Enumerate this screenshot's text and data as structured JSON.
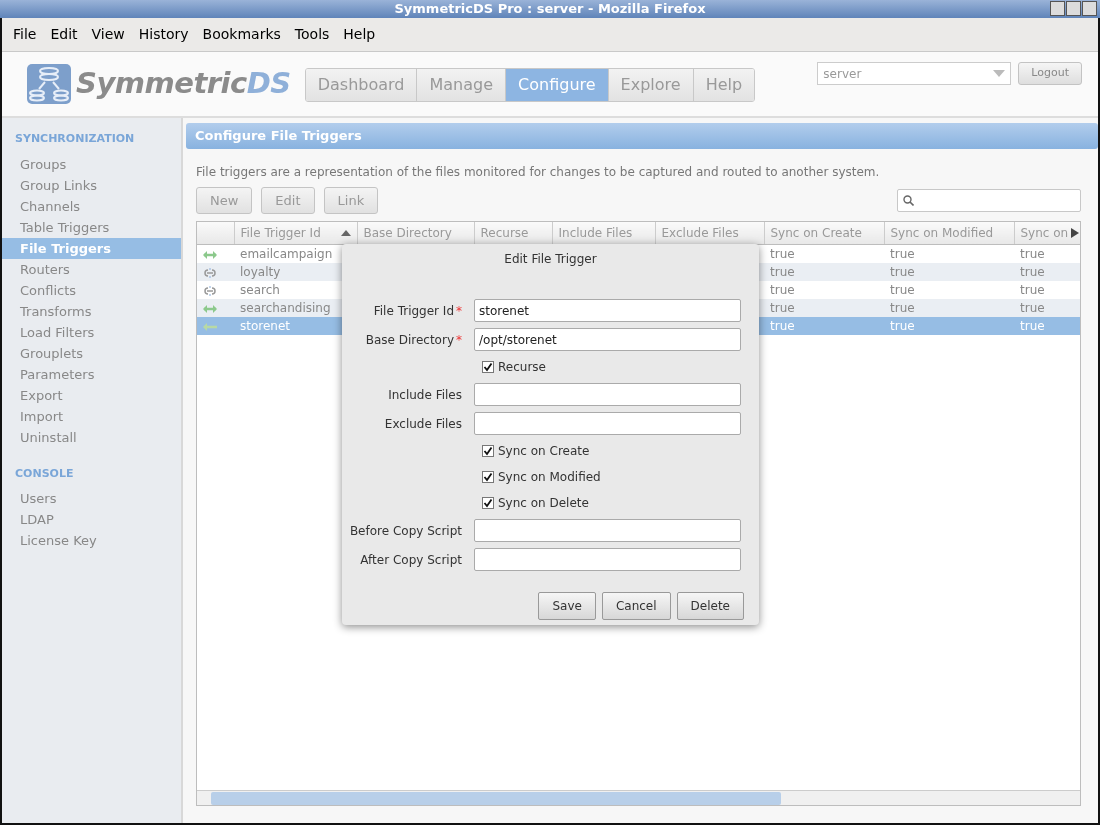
{
  "window": {
    "title": "SymmetricDS Pro : server - Mozilla Firefox"
  },
  "menu": [
    {
      "label": "File"
    },
    {
      "label": "Edit"
    },
    {
      "label": "View"
    },
    {
      "label": "History"
    },
    {
      "label": "Bookmarks"
    },
    {
      "label": "Tools"
    },
    {
      "label": "Help"
    }
  ],
  "logo": {
    "name": "Symmetric",
    "suffix": "DS"
  },
  "nav": [
    {
      "label": "Dashboard",
      "selected": false
    },
    {
      "label": "Manage",
      "selected": false
    },
    {
      "label": "Configure",
      "selected": true
    },
    {
      "label": "Explore",
      "selected": false
    },
    {
      "label": "Help",
      "selected": false
    }
  ],
  "server_select": {
    "value": "server"
  },
  "logout": "Logout",
  "sidebar": [
    {
      "heading": "SYNCHRONIZATION",
      "items": [
        {
          "label": "Groups",
          "selected": false
        },
        {
          "label": "Group Links",
          "selected": false
        },
        {
          "label": "Channels",
          "selected": false
        },
        {
          "label": "Table Triggers",
          "selected": false
        },
        {
          "label": "File Triggers",
          "selected": true
        },
        {
          "label": "Routers",
          "selected": false
        },
        {
          "label": "Conflicts",
          "selected": false
        },
        {
          "label": "Transforms",
          "selected": false
        },
        {
          "label": "Load Filters",
          "selected": false
        },
        {
          "label": "Grouplets",
          "selected": false
        },
        {
          "label": "Parameters",
          "selected": false
        },
        {
          "label": "Export",
          "selected": false
        },
        {
          "label": "Import",
          "selected": false
        },
        {
          "label": "Uninstall",
          "selected": false
        }
      ]
    },
    {
      "heading": "CONSOLE",
      "items": [
        {
          "label": "Users",
          "selected": false
        },
        {
          "label": "LDAP",
          "selected": false
        },
        {
          "label": "License Key",
          "selected": false
        }
      ]
    }
  ],
  "page_title": "Configure File Triggers",
  "description": "File triggers are a representation of the files monitored for changes to be captured and routed to another system.",
  "toolbar": [
    "New",
    "Edit",
    "Link"
  ],
  "table": {
    "columns": [
      "File Trigger Id",
      "Base Directory",
      "Recurse",
      "Include Files",
      "Exclude Files",
      "Sync on Create",
      "Sync on Modified",
      "Sync on"
    ],
    "rows": [
      {
        "kind": "both",
        "selected": false,
        "id": "emailcampaign",
        "sync_on_create": "true",
        "sync_on_modified": "true",
        "sync_on_delete": "true"
      },
      {
        "kind": "unlinked",
        "selected": false,
        "id": "loyalty",
        "sync_on_create": "true",
        "sync_on_modified": "true",
        "sync_on_delete": "true"
      },
      {
        "kind": "unlinked",
        "selected": false,
        "id": "search",
        "sync_on_create": "true",
        "sync_on_modified": "true",
        "sync_on_delete": "true"
      },
      {
        "kind": "both",
        "selected": false,
        "id": "searchandising",
        "sync_on_create": "true",
        "sync_on_modified": "true",
        "sync_on_delete": "true"
      },
      {
        "kind": "incoming",
        "selected": true,
        "id": "storenet",
        "sync_on_create": "true",
        "sync_on_modified": "true",
        "sync_on_delete": "true"
      }
    ]
  },
  "dialog": {
    "title": "Edit File Trigger",
    "fields": [
      {
        "kind": "text",
        "label": "File Trigger Id",
        "required": true,
        "value": "storenet"
      },
      {
        "kind": "text",
        "label": "Base Directory",
        "required": true,
        "value": "/opt/storenet"
      },
      {
        "kind": "check",
        "label": "Recurse",
        "checked": true
      },
      {
        "kind": "text",
        "label": "Include Files",
        "required": false
      },
      {
        "kind": "text",
        "label": "Exclude Files",
        "required": false
      },
      {
        "kind": "check",
        "label": "Sync on Create",
        "checked": true
      },
      {
        "kind": "check",
        "label": "Sync on Modified",
        "checked": true
      },
      {
        "kind": "check",
        "label": "Sync on Delete",
        "checked": true
      },
      {
        "kind": "text",
        "label": "Before Copy Script",
        "required": false
      },
      {
        "kind": "text",
        "label": "After Copy Script",
        "required": false
      }
    ],
    "buttons": [
      "Save",
      "Cancel",
      "Delete"
    ],
    "required_mark": "*"
  }
}
